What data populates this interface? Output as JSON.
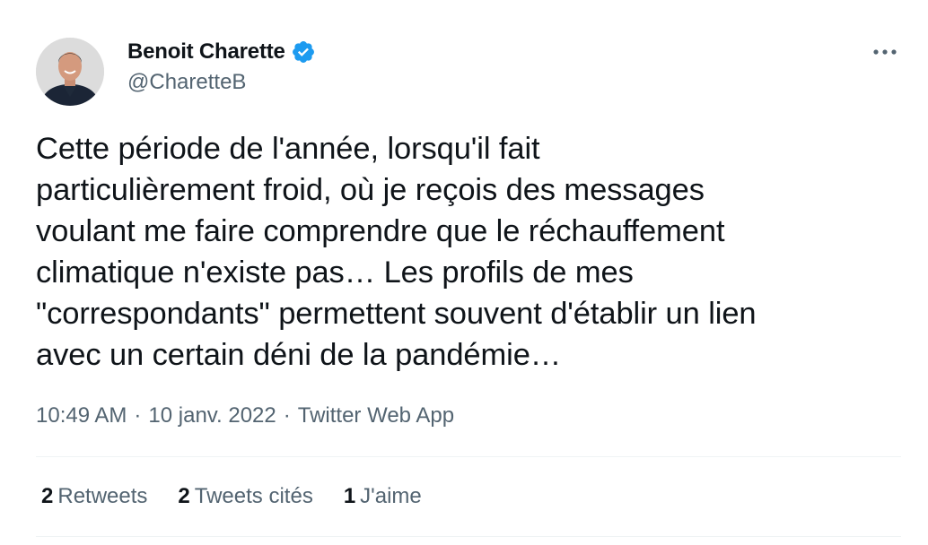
{
  "author": {
    "display_name": "Benoit Charette",
    "handle": "@CharetteB",
    "verified": true,
    "verified_color": "#1d9bf0"
  },
  "tweet": {
    "text": "Cette période de l'année, lorsqu'il fait\nparticulièrement froid, où je reçois des messages\nvoulant me faire comprendre que le réchauffement\nclimatique n'existe pas… Les profils de mes\n\"correspondants\" permettent souvent d'établir un lien\navec un certain déni de la pandémie…",
    "time": "10:49 AM",
    "date": "10 janv. 2022",
    "source": "Twitter Web App",
    "separator": "·"
  },
  "stats": {
    "retweets_count": "2",
    "retweets_label": "Retweets",
    "quotes_count": "2",
    "quotes_label": "Tweets cités",
    "likes_count": "1",
    "likes_label": "J'aime"
  },
  "icons": {
    "more": "more-horizontal-icon",
    "verified": "verified-badge-icon"
  }
}
